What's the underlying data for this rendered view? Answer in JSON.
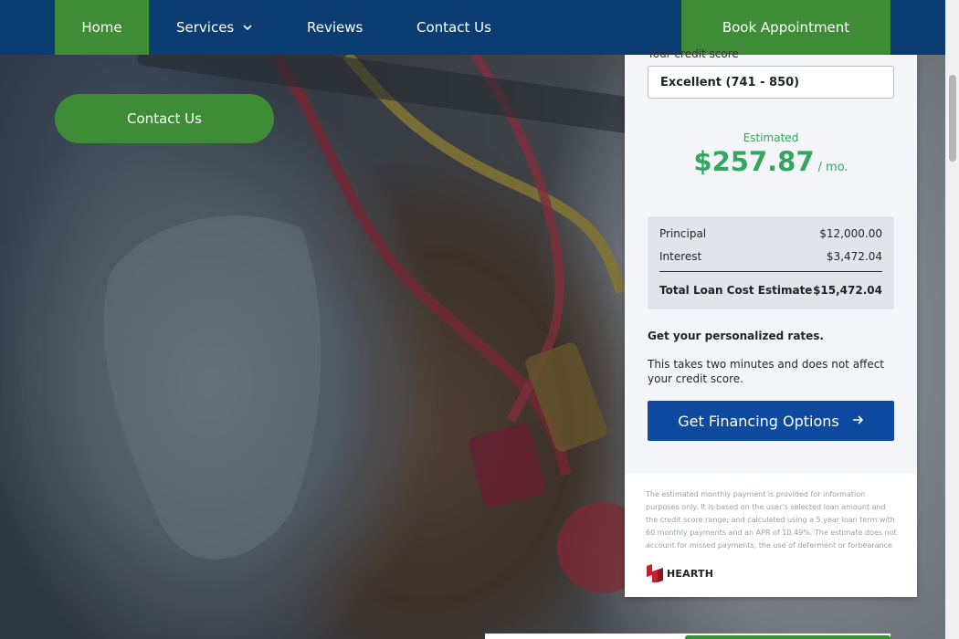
{
  "nav": {
    "home": "Home",
    "services": "Services",
    "reviews": "Reviews",
    "contact": "Contact Us",
    "book": "Book Appointment"
  },
  "hero": {
    "cta": "Contact Us"
  },
  "calculator": {
    "score_label": "Your credit score",
    "score_value": "Excellent (741 - 850)",
    "estimated_label": "Estimated",
    "monthly_payment": "$257.87",
    "per_month": "/ mo.",
    "principal_label": "Principal",
    "principal_value": "$12,000.00",
    "interest_label": "Interest",
    "interest_value": "$3,472.04",
    "total_label": "Total Loan Cost Estimate",
    "total_value": "$15,472.04",
    "personal_title": "Get your personalized rates.",
    "personal_body": "This takes two minutes and does not affect your credit score.",
    "cta": "Get Financing Options",
    "disclaimer": "The estimated monthly payment is provided for information purposes only. It is based on the user's selected loan amount and the credit score range; and calculated using a 5 year loan term with 60 monthly payments and an APR of 10.49%. The estimate does not account for missed payments, the use of deferment or forbearance",
    "logo_text": "HEARTH"
  },
  "colors": {
    "nav_bg": "#0b3d73",
    "accent_green": "#3e8d36",
    "payment_green": "#35a561",
    "button_blue": "#0d4aa0"
  }
}
